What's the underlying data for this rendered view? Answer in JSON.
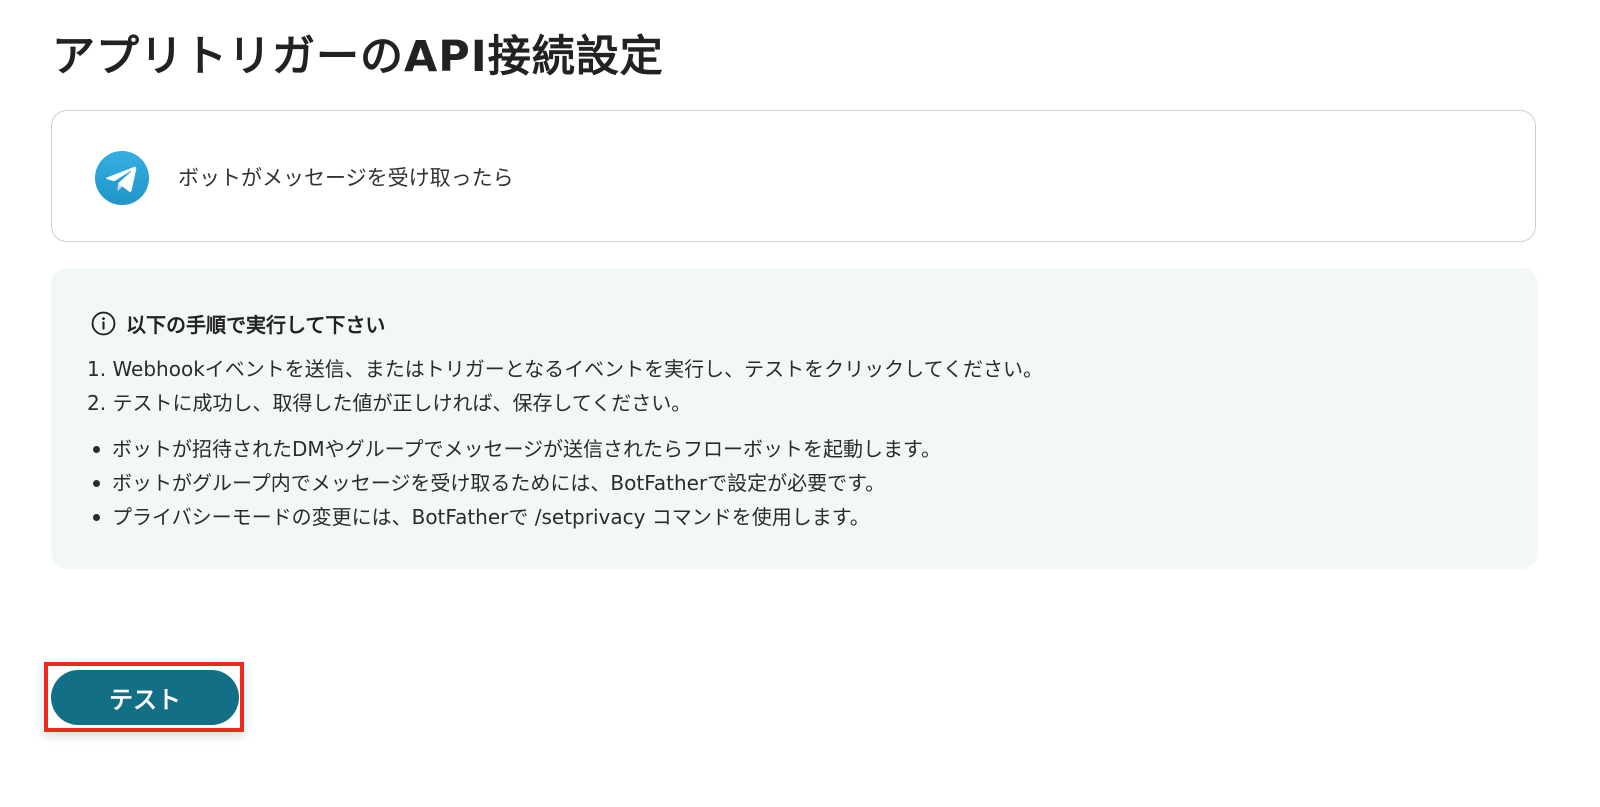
{
  "page": {
    "title": "アプリトリガーのAPI接続設定"
  },
  "trigger": {
    "app_icon": "telegram-icon",
    "label": "ボットがメッセージを受け取ったら"
  },
  "instructions": {
    "icon": "info-icon",
    "heading": "以下の手順で実行して下さい",
    "steps": [
      "1. Webhookイベントを送信、またはトリガーとなるイベントを実行し、テストをクリックしてください。",
      "2. テストに成功し、取得した値が正しければ、保存してください。"
    ],
    "notes": [
      "ボットが招待されたDMやグループでメッセージが送信されたらフローボットを起動します。",
      "ボットがグループ内でメッセージを受け取るためには、BotFatherで設定が必要です。",
      "プライバシーモードの変更には、BotFatherで /setprivacy コマンドを使用します。"
    ]
  },
  "actions": {
    "test_label": "テスト"
  },
  "colors": {
    "accent": "#126f86",
    "highlight": "#ee2a1a",
    "info_background": "#f2f8f8",
    "telegram_blue": "#2aa1da"
  }
}
